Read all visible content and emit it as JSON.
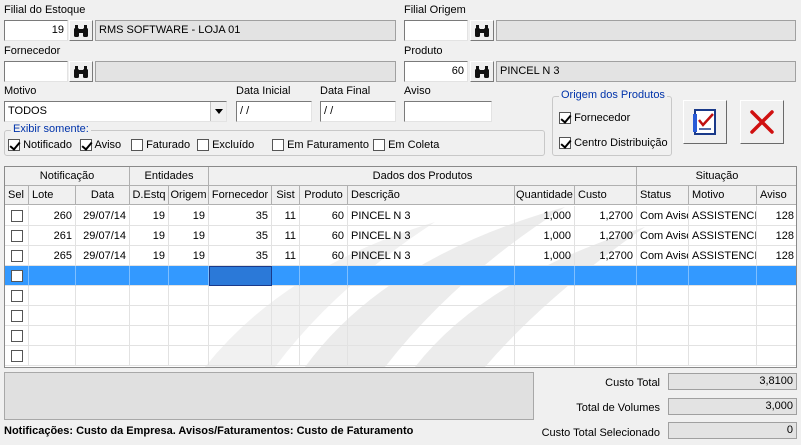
{
  "filters": {
    "filial_estoque_label": "Filial do Estoque",
    "filial_estoque_value": "19",
    "filial_estoque_name": "RMS SOFTWARE - LOJA 01",
    "filial_origem_label": "Filial Origem",
    "filial_origem_value": "",
    "filial_origem_name": "",
    "fornecedor_label": "Fornecedor",
    "fornecedor_value": "",
    "fornecedor_name": "",
    "produto_label": "Produto",
    "produto_value": "60",
    "produto_name": "PINCEL N 3",
    "motivo_label": "Motivo",
    "motivo_value": "TODOS",
    "data_inicial_label": "Data Inicial",
    "data_inicial_value": " / /",
    "data_final_label": "Data Final",
    "data_final_value": " / /",
    "aviso_label": "Aviso",
    "aviso_value": ""
  },
  "exibir": {
    "title": "Exibir somente:",
    "options": [
      {
        "label": "Notificado",
        "checked": true
      },
      {
        "label": "Aviso",
        "checked": true
      },
      {
        "label": "Faturado",
        "checked": false
      },
      {
        "label": "Excluído",
        "checked": false
      },
      {
        "label": "Em Faturamento",
        "checked": false
      },
      {
        "label": "Em Coleta",
        "checked": false
      }
    ]
  },
  "origem": {
    "title": "Origem dos  Produtos",
    "options": [
      {
        "label": "Fornecedor",
        "checked": true
      },
      {
        "label": "Centro Distribuição",
        "checked": true
      }
    ]
  },
  "grid": {
    "groups": [
      "Notificação",
      "Entidades",
      "Dados dos Produtos",
      "Situação"
    ],
    "columns": [
      "Sel",
      "Lote",
      "Data",
      "D.Estq",
      "Origem",
      "Fornecedor",
      "Sist",
      "Produto",
      "Descrição",
      "Quantidade",
      "Custo",
      "Status",
      "Motivo",
      "Aviso"
    ],
    "rows": [
      [
        "260",
        "29/07/14",
        "19",
        "19",
        "35",
        "11",
        "60",
        "PINCEL N 3",
        "1,000",
        "1,2700",
        "Com Aviso",
        "ASSISTENCIA",
        "128"
      ],
      [
        "261",
        "29/07/14",
        "19",
        "19",
        "35",
        "11",
        "60",
        "PINCEL N 3",
        "1,000",
        "1,2700",
        "Com Aviso",
        "ASSISTENCIA",
        "128"
      ],
      [
        "265",
        "29/07/14",
        "19",
        "19",
        "35",
        "11",
        "60",
        "PINCEL N 3",
        "1,000",
        "1,2700",
        "Com Aviso",
        "ASSISTENCIA",
        "128"
      ]
    ]
  },
  "totals": {
    "custo_total_label": "Custo Total",
    "custo_total_value": "3,8100",
    "total_volumes_label": "Total de Volumes",
    "total_volumes_value": "3,000",
    "custo_selecionado_label": "Custo Total Selecionado",
    "custo_selecionado_value": "0"
  },
  "footer_note": "Notificações: Custo da Empresa. Avisos/Faturamentos: Custo de Faturamento",
  "colors": {
    "selection": "#3399ff",
    "group_title": "#0033aa",
    "cancel_red": "#d01010"
  },
  "icons": {
    "search": "binoculars-icon",
    "confirm": "checklist-icon",
    "cancel": "close-icon"
  }
}
